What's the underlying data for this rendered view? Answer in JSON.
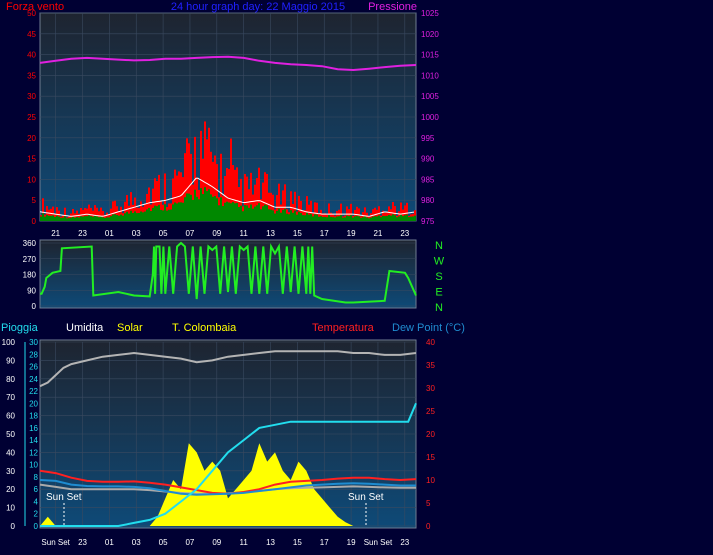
{
  "colors": {
    "background": "#000033",
    "plot_top": "#1e2430",
    "plot_bottom": "#0e4a78",
    "frame": "#6f7d90",
    "wind_gust": "#ff0000",
    "wind_avg": "#ffffff",
    "wind_speed_fill": "#008800",
    "pressure": "#e020e0",
    "direction": "#22ee22",
    "humidity": "#b4b4b4",
    "solar": "#ffff00",
    "temp_colombaia": "#aaaaaa",
    "temperature": "#ff2020",
    "dew_point": "#1f8cd0",
    "rain": "#22ddee",
    "sun_text": "#ffffff",
    "title": "#2020ff"
  },
  "chart_data": [
    {
      "id": "wind_pressure",
      "type": "area",
      "title": "24 hour graph day:  22 Maggio 2015",
      "left_axis_label": "Forza vento",
      "right_axis_label": "Pressione",
      "left_ticks": [
        "0",
        "5",
        "10",
        "15",
        "20",
        "25",
        "30",
        "35",
        "40",
        "45",
        "50"
      ],
      "right_ticks": [
        "975",
        "980",
        "985",
        "990",
        "995",
        "1000",
        "1005",
        "1010",
        "1015",
        "1020",
        "1025"
      ],
      "x_ticks": [
        "21",
        "23",
        "01",
        "03",
        "05",
        "07",
        "09",
        "11",
        "13",
        "15",
        "17",
        "19",
        "21",
        "23"
      ],
      "ylim_left": [
        0,
        50
      ],
      "ylim_right": [
        975,
        1025
      ],
      "series": [
        {
          "name": "Forza vento",
          "x": [
            0,
            1,
            2,
            3,
            4,
            5,
            6,
            7,
            8,
            9,
            10,
            11,
            12,
            13,
            14,
            15,
            16,
            17,
            18,
            19,
            20,
            21,
            22,
            23,
            24
          ],
          "values": [
            4,
            3,
            2,
            3,
            2,
            4,
            6,
            8,
            9,
            11,
            19,
            15,
            10,
            8,
            9,
            6,
            6,
            4,
            3,
            3,
            3,
            2,
            4,
            3,
            4
          ]
        },
        {
          "name": "Pressione",
          "x": [
            0,
            1,
            2,
            3,
            4,
            5,
            6,
            7,
            8,
            9,
            10,
            11,
            12,
            13,
            14,
            15,
            16,
            17,
            18,
            19,
            20,
            21,
            22,
            23,
            24
          ],
          "values": [
            1013,
            1013.5,
            1014,
            1014.2,
            1014,
            1013.8,
            1013.6,
            1013.7,
            1014,
            1014,
            1014.2,
            1014.4,
            1014.5,
            1014.2,
            1013.5,
            1013,
            1012.7,
            1012.5,
            1012.2,
            1011.5,
            1011.3,
            1011.6,
            1012,
            1012.3,
            1012.5
          ]
        }
      ]
    },
    {
      "id": "wind_direction",
      "type": "line",
      "left_ticks": [
        "0",
        "90",
        "180",
        "270",
        "360"
      ],
      "right_labels": [
        "N",
        "W",
        "S",
        "E",
        "N"
      ],
      "ylim": [
        0,
        360
      ],
      "series": [
        {
          "name": "direction",
          "x": [
            0,
            0.1,
            0.3,
            0.4,
            0.8,
            1.3,
            1.4,
            3.3,
            3.4,
            5.0,
            6.0,
            7.0,
            7.2,
            7.5,
            8.0,
            9.0,
            10.0,
            11.0,
            12.0,
            13.0,
            14.0,
            15.0,
            16.0,
            17.0,
            17.5,
            18.0,
            19.5,
            20.0,
            22.0,
            22.3,
            23.3,
            23.5,
            24.0
          ],
          "values": [
            70,
            70,
            110,
            160,
            190,
            200,
            330,
            340,
            60,
            80,
            60,
            55,
            180,
            340,
            70,
            360,
            40,
            320,
            80,
            320,
            70,
            300,
            80,
            70,
            60,
            40,
            20,
            20,
            30,
            200,
            190,
            160,
            60
          ]
        }
      ]
    },
    {
      "id": "temp_humidity",
      "type": "line",
      "header_labels": [
        "Pioggia",
        "Umidita",
        "Solar",
        "T. Colombaia",
        "Temperatura",
        "Dew Point (°C)"
      ],
      "left_ticks": [
        "0",
        "10",
        "20",
        "30",
        "40",
        "50",
        "60",
        "70",
        "80",
        "90",
        "100"
      ],
      "rain_ticks": [
        "0",
        "2",
        "4",
        "6",
        "8",
        "10",
        "12",
        "14",
        "16",
        "18",
        "20",
        "22",
        "24",
        "26",
        "28",
        "30"
      ],
      "right_ticks": [
        "0",
        "5",
        "10",
        "15",
        "20",
        "25",
        "30",
        "35",
        "40"
      ],
      "x_ticks": [
        "Sun Set",
        "23",
        "01",
        "03",
        "05",
        "07",
        "09",
        "11",
        "13",
        "15",
        "17",
        "19",
        "Sun Set",
        "23"
      ],
      "sun_labels": [
        "Sun Set",
        "Sun Set"
      ],
      "ylim_humidity": [
        0,
        100
      ],
      "ylim_temperature": [
        0,
        40
      ],
      "series": [
        {
          "name": "Umidita",
          "x": [
            0,
            0.5,
            1,
            1.5,
            2,
            3,
            4,
            5,
            6,
            7,
            8,
            9,
            10,
            11,
            12,
            13,
            14,
            15,
            16,
            17,
            18,
            19,
            20,
            21,
            22,
            23,
            24
          ],
          "values": [
            76,
            78,
            82,
            86,
            88,
            90,
            92,
            93,
            94,
            93,
            92,
            91,
            89,
            90,
            92,
            93,
            94,
            95,
            95,
            95,
            95,
            95,
            94,
            94,
            93,
            93,
            94
          ]
        },
        {
          "name": "Temperatura",
          "x": [
            0,
            1,
            2,
            3,
            4,
            5,
            6,
            7,
            8,
            9,
            10,
            11,
            12,
            13,
            14,
            15,
            16,
            17,
            18,
            19,
            20,
            21,
            22,
            23,
            24
          ],
          "values": [
            12,
            11.5,
            10.5,
            9.8,
            9.6,
            9.6,
            9.7,
            9.4,
            9,
            8.4,
            7.8,
            7.2,
            7.0,
            7.4,
            8,
            9,
            9.6,
            9.8,
            10,
            10.3,
            10.5,
            10.5,
            10.2,
            10,
            10.2
          ]
        },
        {
          "name": "Dew Point",
          "x": [
            0,
            1,
            2,
            3,
            4,
            5,
            6,
            7,
            8,
            9,
            10,
            11,
            12,
            13,
            14,
            15,
            16,
            17,
            18,
            19,
            20,
            21,
            22,
            23,
            24
          ],
          "values": [
            10,
            9.8,
            9.0,
            8.7,
            8.6,
            8.6,
            8.5,
            8.2,
            7.6,
            7.0,
            6.8,
            6.9,
            7.0,
            7.2,
            7.6,
            8.0,
            8.4,
            8.8,
            9.0,
            9.2,
            9.3,
            9.2,
            9.0,
            8.8,
            8.8
          ]
        },
        {
          "name": "T. Colombaia",
          "x": [
            0,
            1,
            2,
            3,
            4,
            5,
            6,
            7,
            8,
            9,
            10,
            11,
            12,
            13,
            14,
            15,
            16,
            17,
            18,
            19,
            20,
            21,
            22,
            23,
            24
          ],
          "values": [
            9,
            8.5,
            8,
            8,
            8,
            8,
            8,
            7.8,
            7.5,
            7.2,
            7,
            7,
            7.1,
            7.3,
            7.6,
            8,
            8.2,
            8.3,
            8.4,
            8.5,
            8.6,
            8.5,
            8.4,
            8.3,
            8.3
          ]
        },
        {
          "name": "Pioggia",
          "x": [
            0,
            1,
            1.5,
            2,
            3,
            4,
            5,
            6,
            7,
            8,
            9,
            10,
            11,
            12,
            13,
            14,
            15,
            16,
            17,
            18,
            19,
            20,
            21,
            22,
            23,
            23.5,
            24
          ],
          "values": [
            0,
            0,
            0,
            0,
            0,
            0,
            0,
            0.5,
            1,
            2,
            4,
            6,
            9,
            12,
            14,
            16,
            16.5,
            17,
            17,
            17,
            17,
            17,
            17,
            17,
            17,
            17,
            20
          ]
        },
        {
          "name": "Solar",
          "x": [
            0,
            0.5,
            1,
            7,
            7.5,
            8,
            8.5,
            9,
            9.5,
            10,
            10.5,
            11,
            11.5,
            12,
            12.5,
            13,
            13.5,
            14,
            14.5,
            15,
            15.5,
            16,
            16.5,
            17,
            17.5,
            18,
            18.5,
            19,
            19.5,
            20,
            24
          ],
          "values": [
            0,
            5,
            0,
            0,
            5,
            15,
            25,
            20,
            45,
            40,
            30,
            35,
            30,
            15,
            20,
            25,
            30,
            45,
            35,
            40,
            30,
            25,
            35,
            30,
            20,
            15,
            10,
            5,
            2,
            0,
            0
          ]
        }
      ]
    }
  ]
}
